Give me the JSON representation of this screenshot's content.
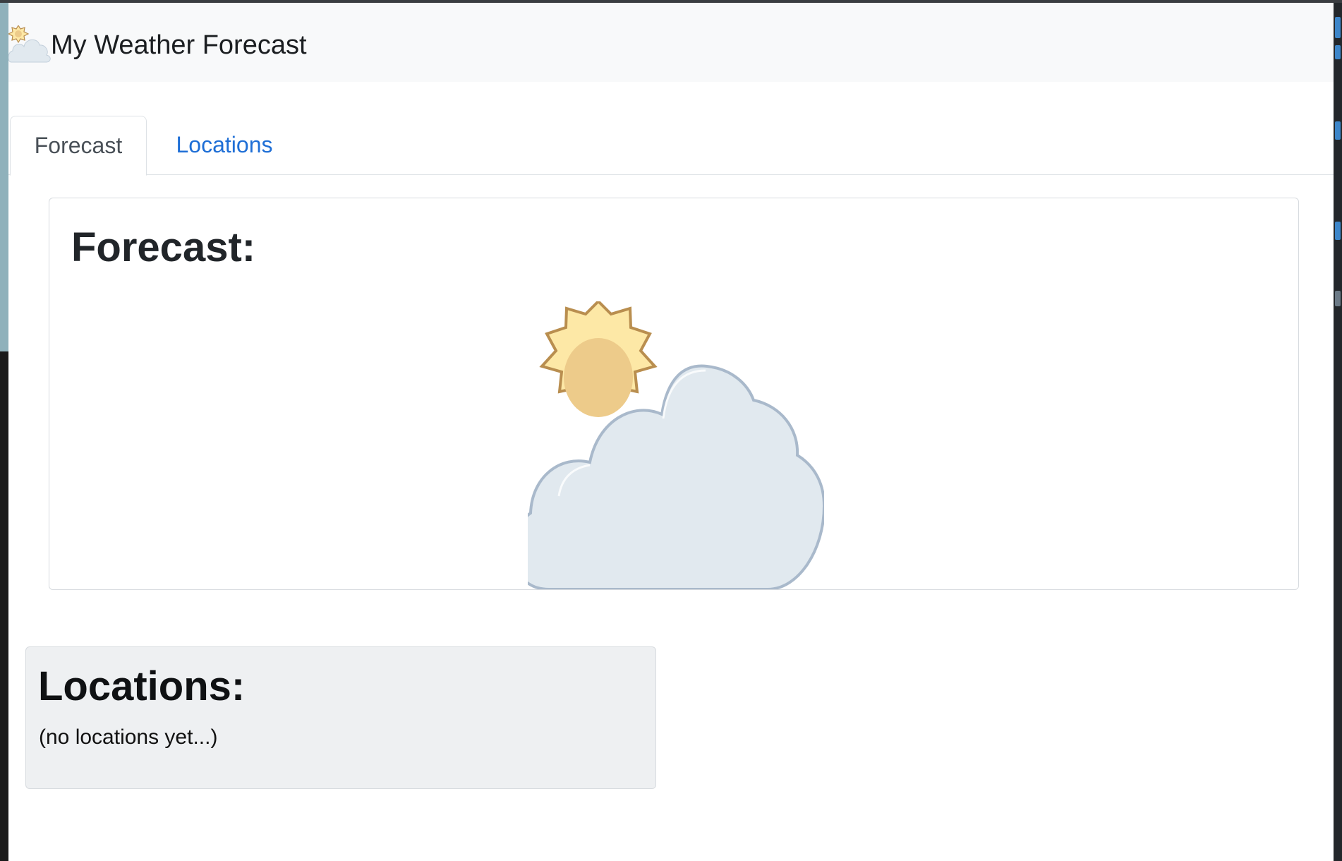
{
  "app": {
    "title": "My Weather Forecast",
    "icon": "partly-cloudy-icon"
  },
  "tabs": [
    {
      "label": "Forecast",
      "active": true
    },
    {
      "label": "Locations",
      "active": false
    }
  ],
  "forecast": {
    "heading": "Forecast:",
    "condition_icon": "partly-cloudy-icon"
  },
  "locations": {
    "heading": "Locations:",
    "empty_message": "(no locations yet...)"
  },
  "colors": {
    "navbar_bg": "#f8f9fa",
    "link": "#1f6fd6",
    "sun_fill": "#fde8a6",
    "sun_core": "#edcb8a",
    "sun_stroke": "#b98e4f",
    "cloud_fill": "#e1e9ef",
    "cloud_stroke": "#a9b9cb",
    "locations_bg": "#eef0f2"
  }
}
